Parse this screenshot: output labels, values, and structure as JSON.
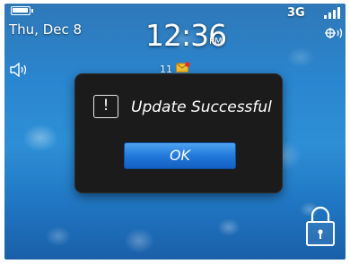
{
  "status_bar": {
    "date": "Thu, Dec 8",
    "time": "12:36",
    "ampm": "PM",
    "network": "3G",
    "unread_count": "11"
  },
  "icons": {
    "battery": "battery-icon",
    "signal": "signal-strength-icon",
    "wifi": "wifi-icon",
    "volume": "volume-icon",
    "message": "message-icon",
    "alert": "alert-icon",
    "lock": "lock-icon"
  },
  "dialog": {
    "alert_glyph": "!",
    "title": "Update Successful",
    "ok_label": "OK"
  },
  "colors": {
    "dialog_bg": "#1b1b1b",
    "button_blue": "#2379dc",
    "wallpaper_blue": "#2d8fd6"
  }
}
